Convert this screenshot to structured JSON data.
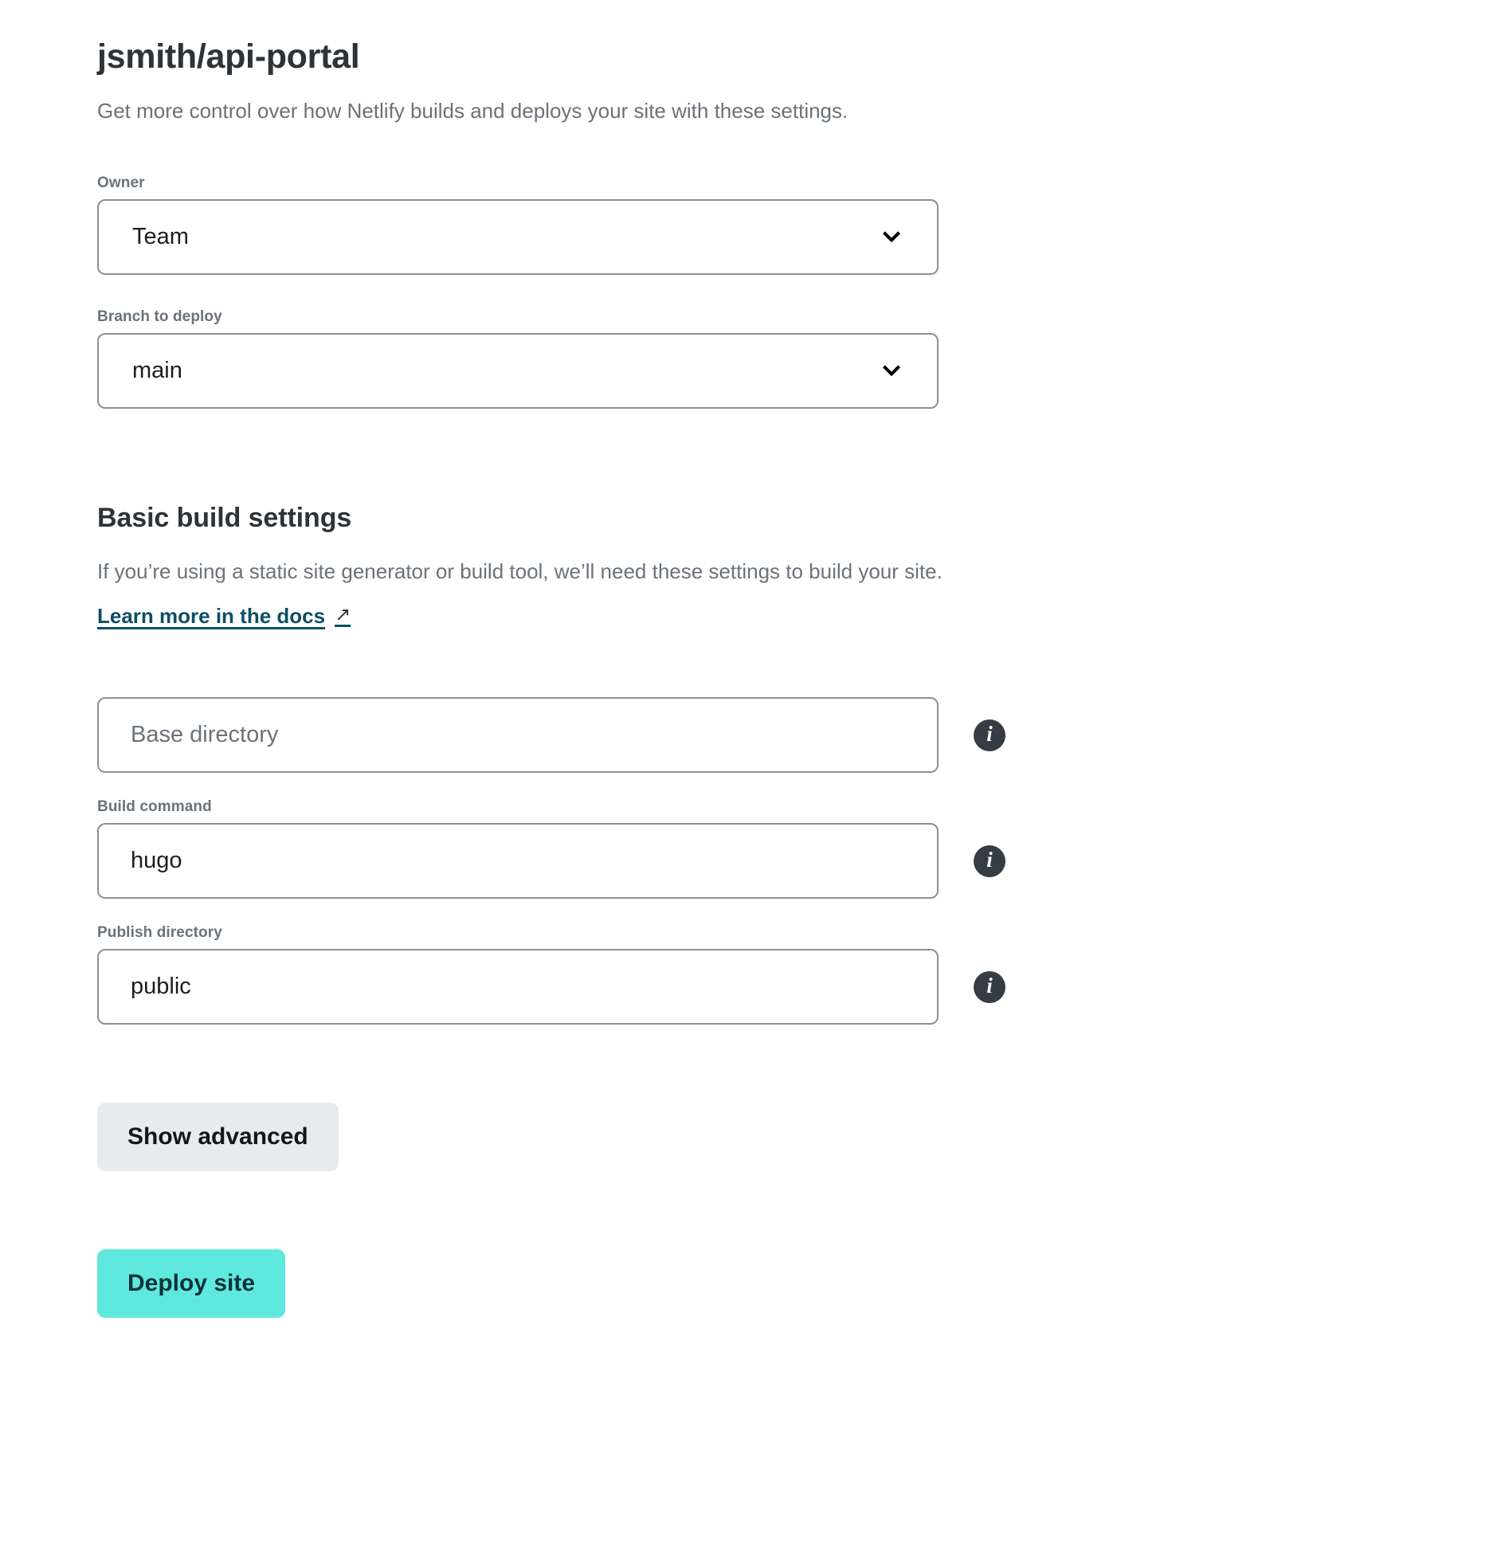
{
  "header": {
    "title": "jsmith/api-portal",
    "subtitle": "Get more control over how Netlify builds and deploys your site with these settings."
  },
  "owner": {
    "label": "Owner",
    "value": "Team",
    "chevron_icon": "chevron-down-icon"
  },
  "branch": {
    "label": "Branch to deploy",
    "value": "main",
    "chevron_icon": "chevron-down-icon"
  },
  "basic_build": {
    "heading": "Basic build settings",
    "description": "If you’re using a static site generator or build tool, we’ll need these settings to build your site.",
    "docs_link": "Learn more in the docs",
    "external_link_icon": "↗"
  },
  "fields": {
    "base_directory": {
      "label": "",
      "placeholder": "Base directory",
      "value": "",
      "info_icon": "info-icon",
      "info_glyph": "i"
    },
    "build_command": {
      "label": "Build command",
      "placeholder": "",
      "value": "hugo",
      "info_icon": "info-icon",
      "info_glyph": "i"
    },
    "publish_directory": {
      "label": "Publish directory",
      "placeholder": "",
      "value": "public",
      "info_icon": "info-icon",
      "info_glyph": "i"
    }
  },
  "buttons": {
    "show_advanced": "Show advanced",
    "deploy_site": "Deploy site"
  },
  "colors": {
    "accent_teal": "#5fe9de",
    "deploy_text": "#0c3239",
    "link": "#0e4f63",
    "muted_text": "#6b7279",
    "heading": "#2e3338",
    "border": "#8a9097",
    "advanced_bg": "#e8ebed",
    "info_bg": "#363c43"
  }
}
